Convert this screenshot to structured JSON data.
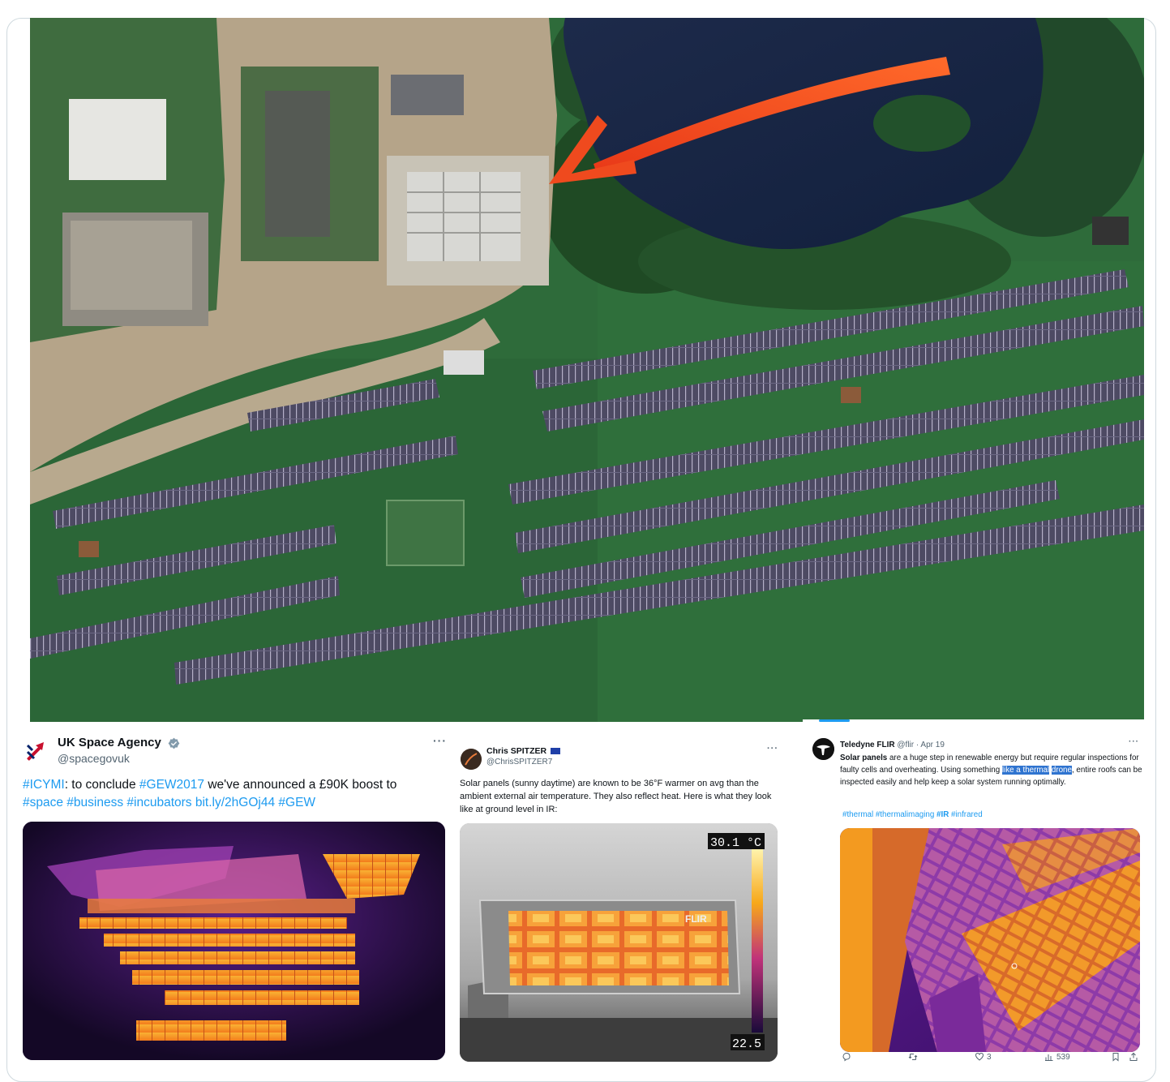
{
  "colors": {
    "link": "#1d9bf0",
    "muted": "#536471",
    "highlight": "#2f74d0",
    "arrow": "#f04a1e",
    "grass": "#2f6a3a",
    "thermal_hot": "#f7a81a",
    "thermal_cold": "#1a0a3a"
  },
  "aerial": {
    "alt": "Satellite view of a solar farm beside a lake with a red arrow pointing at a building"
  },
  "tweet1": {
    "name": "UK Space Agency",
    "handle": "@spacegovuk",
    "more": "···",
    "text_lead": "#ICYMI",
    "text_1": ": to conclude ",
    "tag_gew2017": "#GEW2017",
    "text_2": " we've announced a £90K boost to",
    "tag_space": "#space",
    "tag_business": "#business",
    "tag_incubators": "#incubators",
    "link": "bit.ly/2hGOj44",
    "tag_gew": "#GEW",
    "avatar_icon": "uk-space-agency-logo-icon",
    "verified_icon": "verified-badge-icon"
  },
  "tweet2": {
    "name": "Chris SPITZER",
    "handle": "@ChrisSPITZER7",
    "more": "···",
    "text": "Solar panels (sunny daytime) are known to be 36°F warmer on avg than the ambient external air temperature. They also reflect heat. Here is what they look like at ground level in IR:",
    "thermal_max": "30.1 °C",
    "thermal_min": "22.5",
    "brand": "FLIR"
  },
  "tweet3": {
    "name": "Teledyne FLIR",
    "handle": "@flir",
    "date": "· Apr 19",
    "more": "···",
    "bold_lead": "Solar panels",
    "text_1": " are a huge step in renewable energy but require regular inspections for faulty cells and overheating. Using something ",
    "highlight_1": "like a thermal",
    "highlight_2": "drone",
    "text_2": ", entire roofs can be inspected easily and help keep a solar system running optimally.",
    "tag_thermal": "#thermal",
    "tag_thermalimaging": "#thermalimaging",
    "tag_ir": "#IR",
    "tag_infrared": "#infrared",
    "actions": {
      "reply_count": "",
      "retweet_count": "",
      "like_count": "3",
      "views_count": "539"
    }
  }
}
